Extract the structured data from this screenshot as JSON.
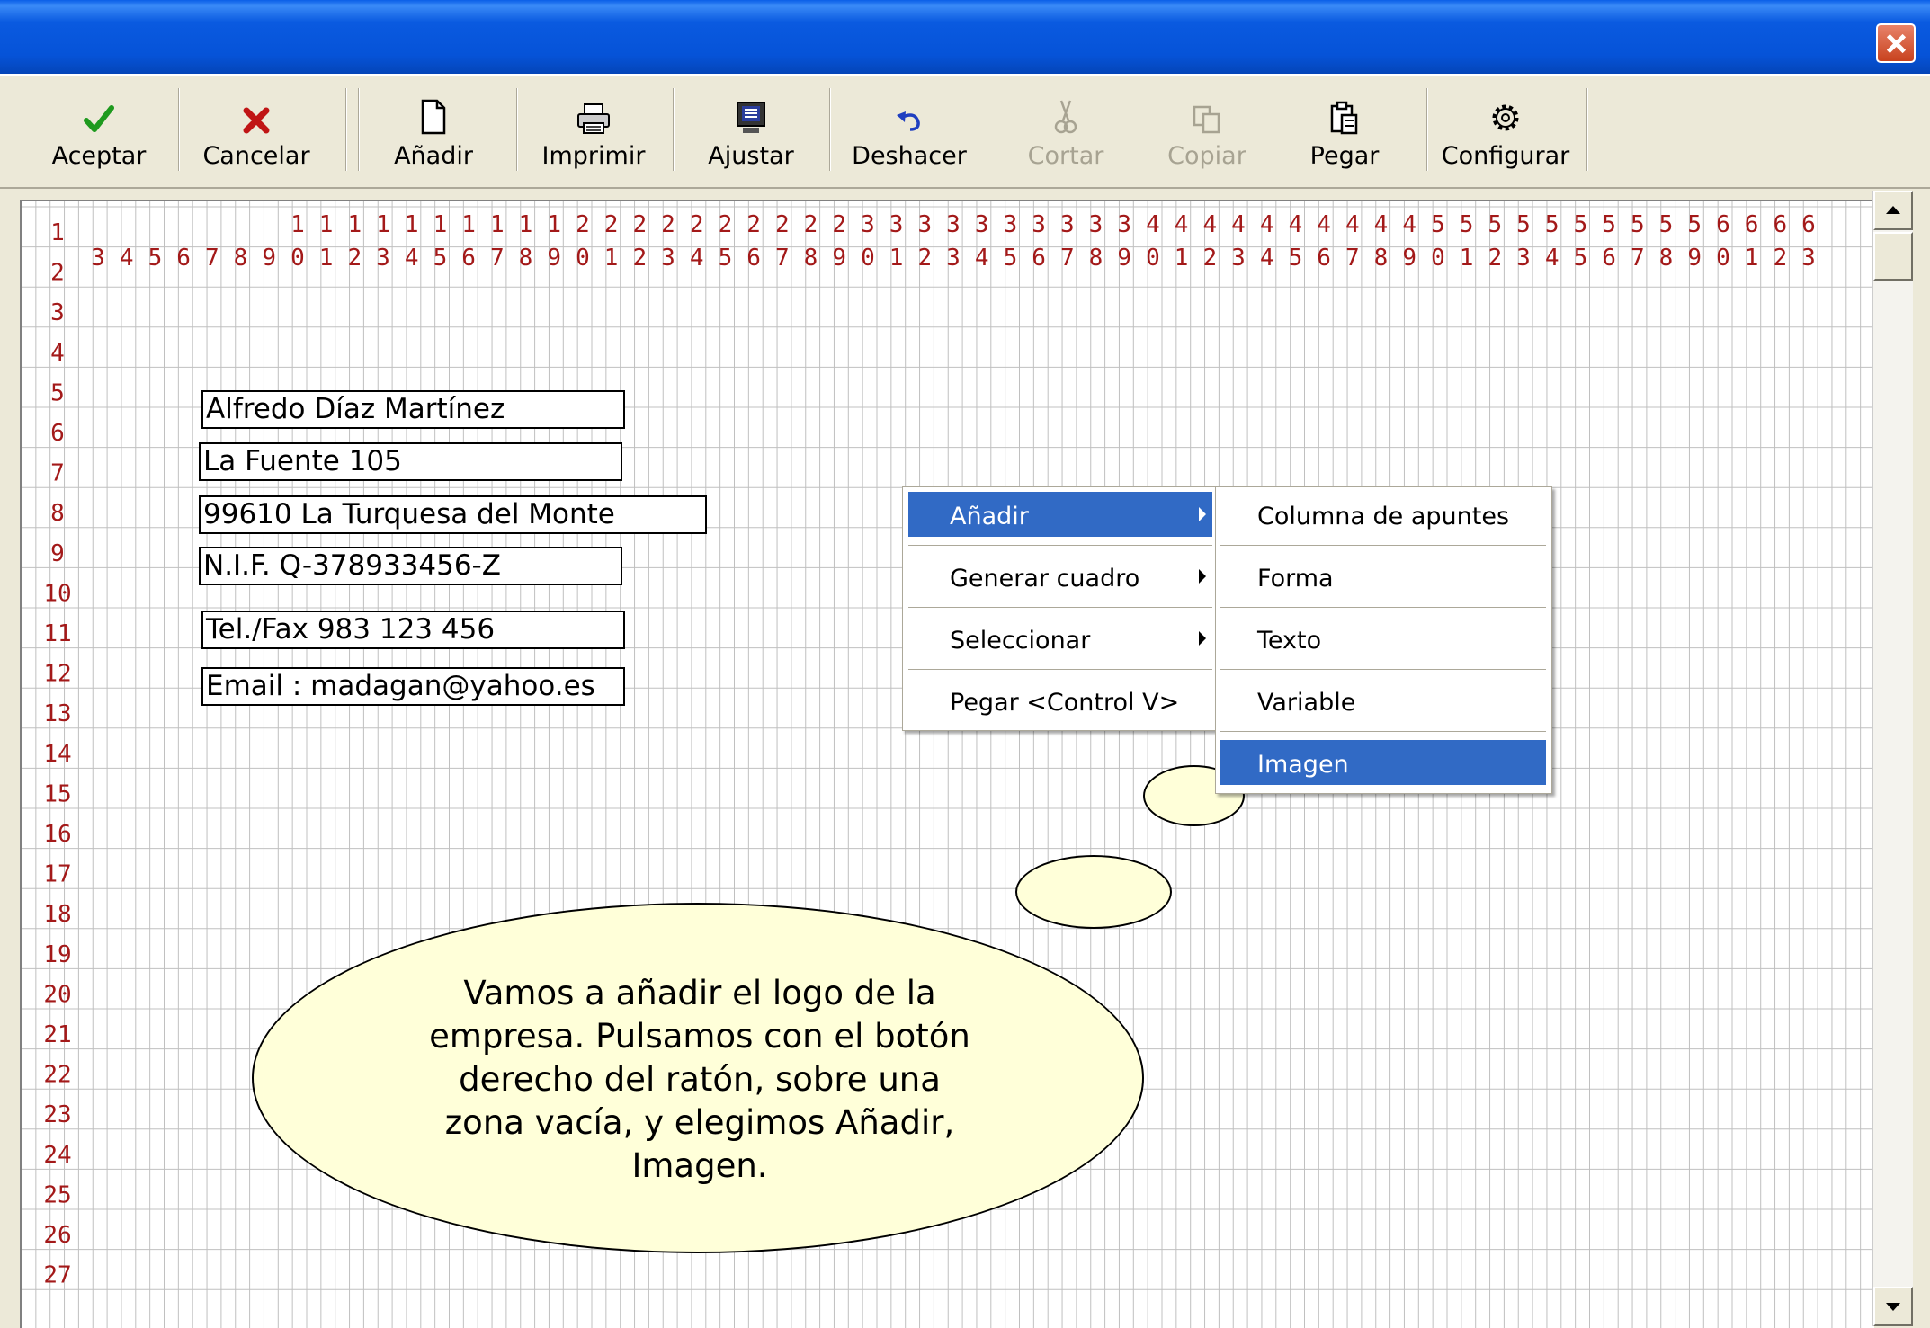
{
  "window": {
    "close_label": "×"
  },
  "toolbar": {
    "buttons": [
      {
        "id": "accept",
        "label": "Aceptar",
        "icon": "checkmark-icon",
        "enabled": true
      },
      {
        "id": "cancel",
        "label": "Cancelar",
        "icon": "x-icon",
        "enabled": true
      },
      {
        "id": "add",
        "label": "Añadir",
        "icon": "new-page-icon",
        "enabled": true
      },
      {
        "id": "print",
        "label": "Imprimir",
        "icon": "printer-icon",
        "enabled": true
      },
      {
        "id": "fit",
        "label": "Ajustar",
        "icon": "monitor-icon",
        "enabled": true
      },
      {
        "id": "undo",
        "label": "Deshacer",
        "icon": "undo-icon",
        "enabled": true
      },
      {
        "id": "cut",
        "label": "Cortar",
        "icon": "scissors-icon",
        "enabled": false
      },
      {
        "id": "copy",
        "label": "Copiar",
        "icon": "copy-icon",
        "enabled": false
      },
      {
        "id": "paste",
        "label": "Pegar",
        "icon": "paste-icon",
        "enabled": true
      },
      {
        "id": "configure",
        "label": "Configurar",
        "icon": "gear-icon",
        "enabled": true
      }
    ]
  },
  "ruler": {
    "column_start": 3,
    "column_end": 63,
    "row_start": 1,
    "row_end": 27,
    "number_color": "#A31919"
  },
  "fields": [
    {
      "text": "Alfredo Díaz Martínez"
    },
    {
      "text": "La Fuente 105"
    },
    {
      "text": "99610 La Turquesa del Monte"
    },
    {
      "text": "N.I.F. Q-378933456-Z"
    },
    {
      "text": "Tel./Fax 983 123 456"
    },
    {
      "text": "Email : madagan@yahoo.es"
    }
  ],
  "context_menu": {
    "items": [
      {
        "label": "Añadir",
        "has_submenu": true,
        "selected": true
      },
      {
        "label": "Generar cuadro",
        "has_submenu": true,
        "selected": false
      },
      {
        "label": "Seleccionar",
        "has_submenu": true,
        "selected": false
      },
      {
        "label": "Pegar <Control V>",
        "has_submenu": false,
        "selected": false
      }
    ]
  },
  "submenu": {
    "items": [
      {
        "label": "Columna de apuntes",
        "selected": false
      },
      {
        "label": "Forma",
        "selected": false
      },
      {
        "label": "Texto",
        "selected": false
      },
      {
        "label": "Variable",
        "selected": false
      },
      {
        "label": "Imagen",
        "selected": true
      }
    ]
  },
  "tip": {
    "text": "Vamos a añadir el logo de la\nempresa. Pulsamos con el botón\nderecho del ratón, sobre una\nzona vacía, y elegimos Añadir,\nImagen."
  },
  "colors": {
    "titlebar": "#0653D8",
    "selection": "#316AC5",
    "bubble": "#FFFFD9",
    "grid_line": "#C0C0C0"
  }
}
